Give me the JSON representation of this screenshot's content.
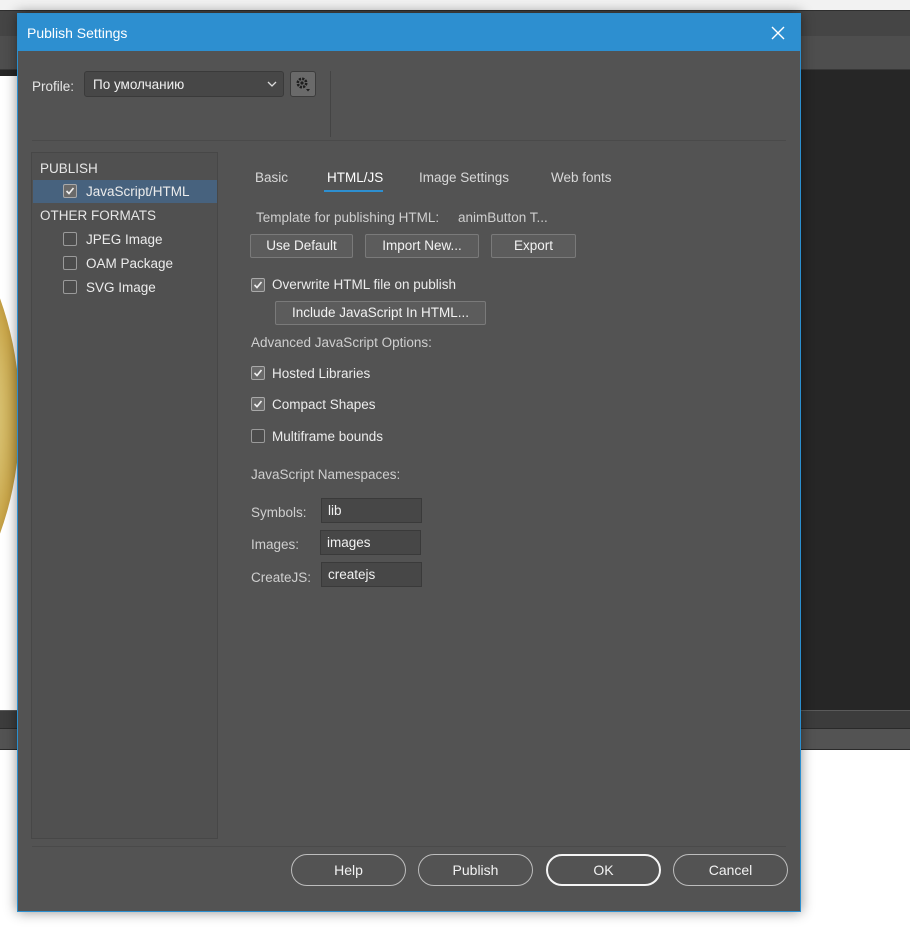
{
  "dialog": {
    "title": "Publish Settings",
    "profile_label": "Profile:",
    "profile_value": "По умолчанию"
  },
  "left_panel": {
    "publish_heading": "PUBLISH",
    "publish_items": [
      {
        "label": "JavaScript/HTML",
        "checked": true,
        "selected": true
      }
    ],
    "other_heading": "OTHER FORMATS",
    "other_items": [
      {
        "label": "JPEG Image",
        "checked": false
      },
      {
        "label": "OAM Package",
        "checked": false
      },
      {
        "label": "SVG Image",
        "checked": false
      }
    ]
  },
  "tabs": [
    {
      "label": "Basic",
      "active": false
    },
    {
      "label": "HTML/JS",
      "active": true
    },
    {
      "label": "Image Settings",
      "active": false
    },
    {
      "label": "Web fonts",
      "active": false
    }
  ],
  "html_js": {
    "template_label": "Template for publishing HTML:",
    "template_value": "animButton T...",
    "use_default": "Use Default",
    "import_new": "Import New...",
    "export": "Export",
    "overwrite_label": "Overwrite HTML file on publish",
    "overwrite_checked": true,
    "include_js": "Include JavaScript In HTML...",
    "advanced_heading": "Advanced JavaScript Options:",
    "hosted_libraries": "Hosted Libraries",
    "hosted_checked": true,
    "compact_shapes": "Compact Shapes",
    "compact_checked": true,
    "multiframe_bounds": "Multiframe bounds",
    "multiframe_checked": false,
    "namespaces_heading": "JavaScript Namespaces:",
    "symbols_label": "Symbols:",
    "symbols_value": "lib",
    "images_label": "Images:",
    "images_value": "images",
    "createjs_label": "CreateJS:",
    "createjs_value": "createjs"
  },
  "footer": {
    "help": "Help",
    "publish": "Publish",
    "ok": "OK",
    "cancel": "Cancel"
  },
  "colors": {
    "accent": "#2d8fd0",
    "dialog_bg": "#535353",
    "selection": "#47627e"
  }
}
